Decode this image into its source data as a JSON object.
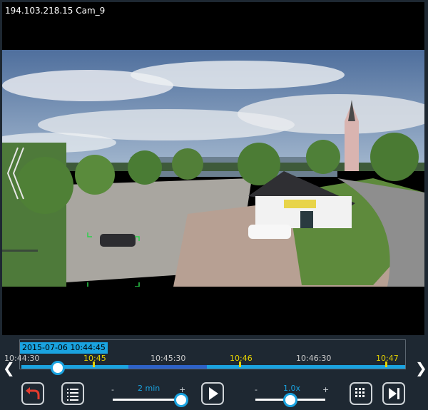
{
  "camera": {
    "title": "194.103.218.15 Cam_9"
  },
  "timeline": {
    "selected_datetime": "2015-07-06 10:44:45",
    "ticks": [
      "10:44:30",
      "10:45",
      "10:45:30",
      "10:46",
      "10:46:30",
      "10:47"
    ]
  },
  "controls": {
    "zoom_label": "2 min",
    "speed_label": "1.0x",
    "minus": "-",
    "plus": "+"
  },
  "colors": {
    "accent": "#1aa3e0",
    "highlight_tick": "#e6d300",
    "panel_bg": "#1e2832"
  },
  "icons": [
    "back-icon",
    "list-icon",
    "play-icon",
    "grid-icon",
    "skip-end-icon",
    "chevron-left-icon",
    "chevron-right-icon"
  ]
}
